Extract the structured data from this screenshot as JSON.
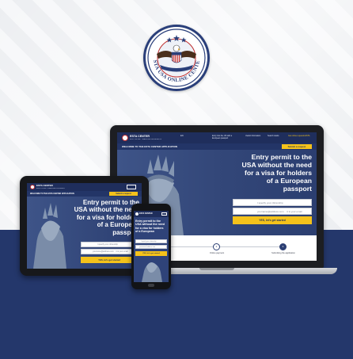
{
  "brand": {
    "seal_text": "ESTA USA ONLINE CENTER",
    "name": "ESTA CENTER",
    "tagline": "ELECTRONIC TRAVEL AUTHORIZATION"
  },
  "header": {
    "welcome": "WELCOME TO THE ESTA CENTER APPLICATION",
    "submit_label": "Submit a request",
    "nav": [
      "Entry Into the US with a European passport",
      "Useful information",
      "Search desks",
      "Get online requests ESTA"
    ],
    "lang": "EN"
  },
  "hero": {
    "line1": "Entry permit to the",
    "line2": "USA without the need",
    "line3": "for a visa for holders",
    "line4": "of a European",
    "line5": "passport"
  },
  "form": {
    "citizenship_placeholder": "I specify your citizenship",
    "email_placeholder": "yourname@address.com",
    "email_suffix": "it is your email",
    "cta": "YES, let's get started"
  },
  "steps": [
    {
      "n": "1",
      "label": "Processing the request"
    },
    {
      "n": "2",
      "label": "Online payment"
    },
    {
      "n": "3",
      "label": "Submitting the application"
    }
  ],
  "colors": {
    "navy": "#24376b",
    "accent": "#f4c21b",
    "header": "#1f2e5c"
  }
}
